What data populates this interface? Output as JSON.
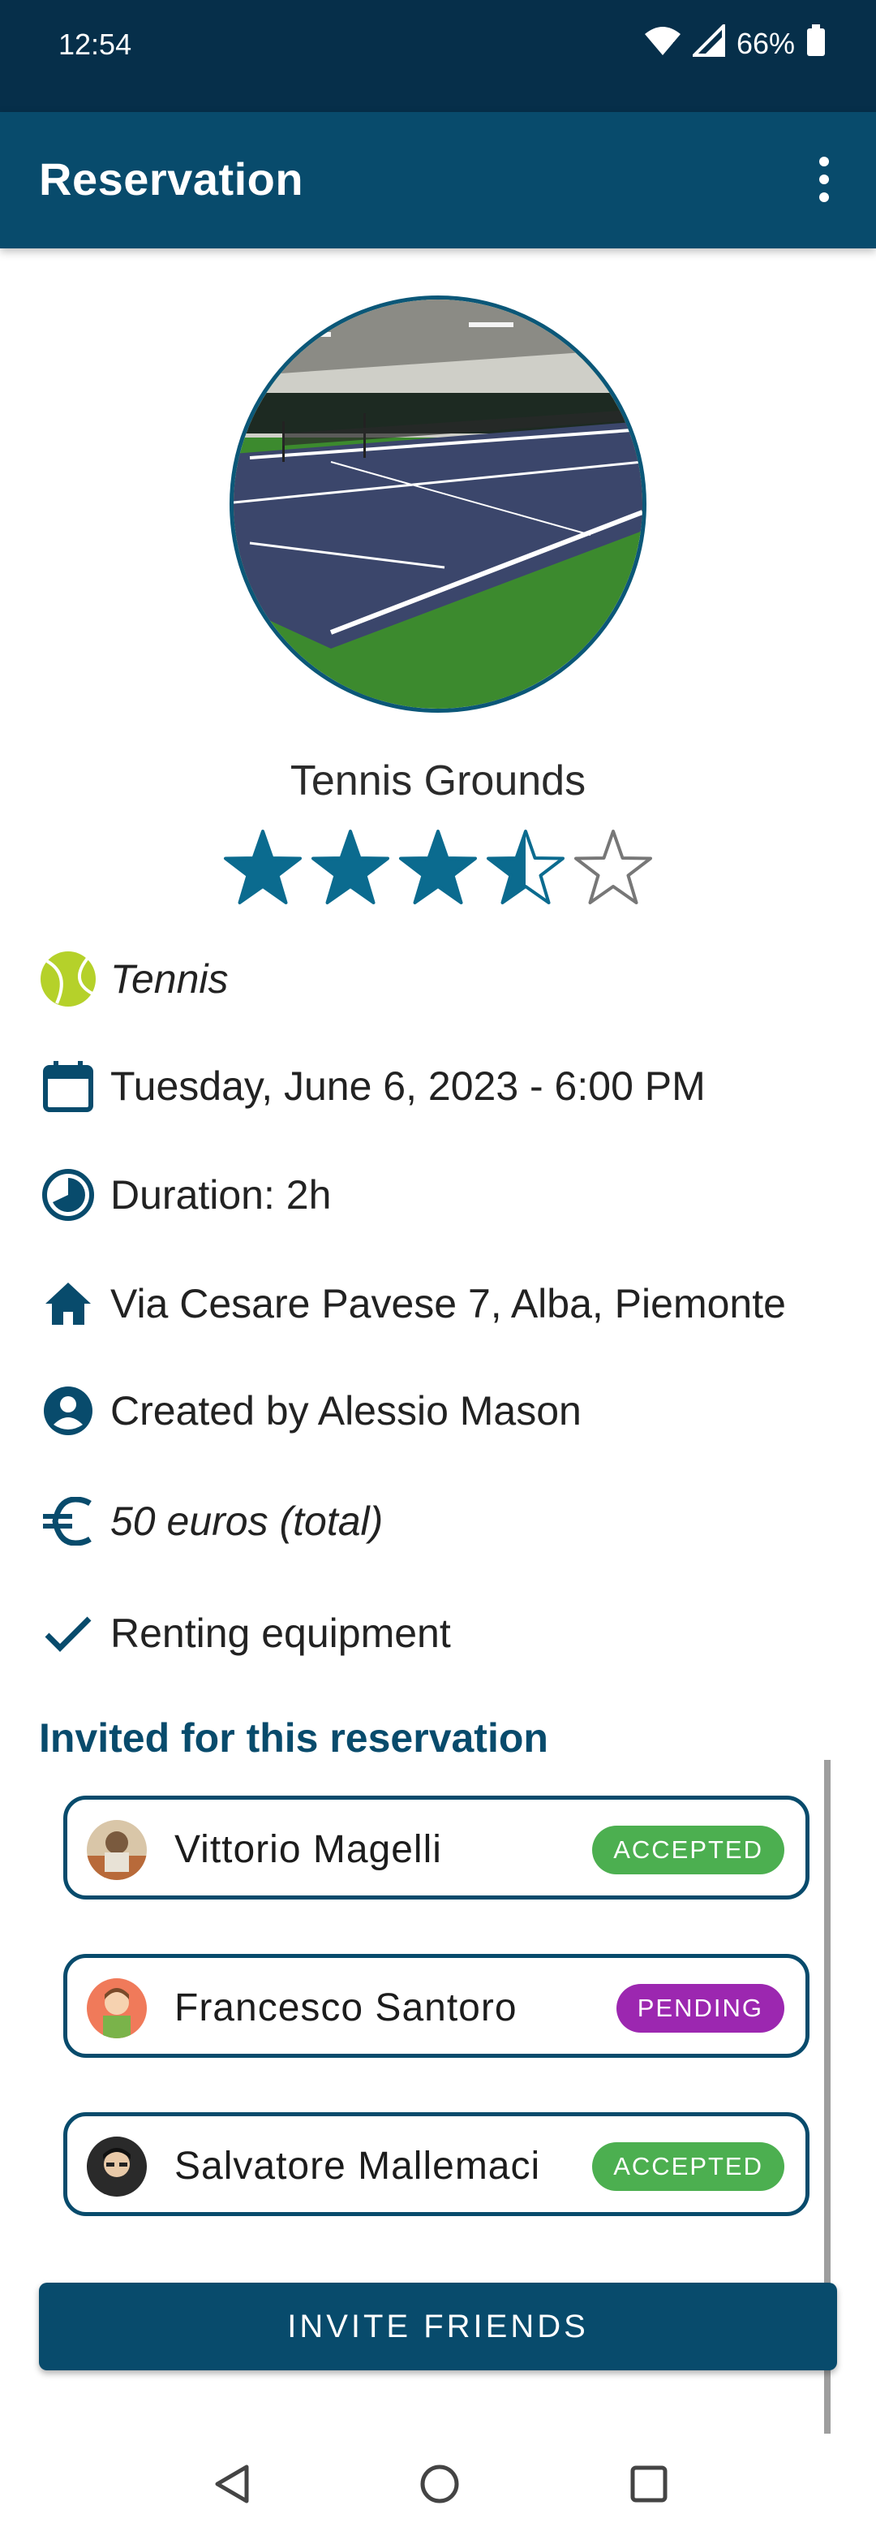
{
  "status_bar": {
    "time": "12:54",
    "battery": "66%"
  },
  "app_bar": {
    "title": "Reservation",
    "menu_icon": "more-vert-icon"
  },
  "facility": {
    "name": "Tennis Grounds",
    "rating": 3.5,
    "rating_max": 5,
    "accent_color": "#0b6b8f"
  },
  "details": {
    "sport": "Tennis",
    "datetime": "Tuesday, June 6, 2023 - 6:00 PM",
    "duration": "Duration: 2h",
    "address": "Via Cesare Pavese 7, Alba, Piemonte",
    "creator": "Created by Alessio Mason",
    "price": "50 euros (total)",
    "equipment": "Renting equipment"
  },
  "invited": {
    "title": "Invited for this reservation",
    "people": [
      {
        "name": "Vittorio Magelli",
        "status": "ACCEPTED",
        "status_color": "#4caf50"
      },
      {
        "name": "Francesco Santoro",
        "status": "PENDING",
        "status_color": "#9c27b0"
      },
      {
        "name": "Salvatore Mallemaci",
        "status": "ACCEPTED",
        "status_color": "#4caf50"
      }
    ]
  },
  "invite_button": {
    "label": "INVITE FRIENDS"
  },
  "colors": {
    "primary": "#084b6c",
    "status_bar": "#062f4a"
  }
}
